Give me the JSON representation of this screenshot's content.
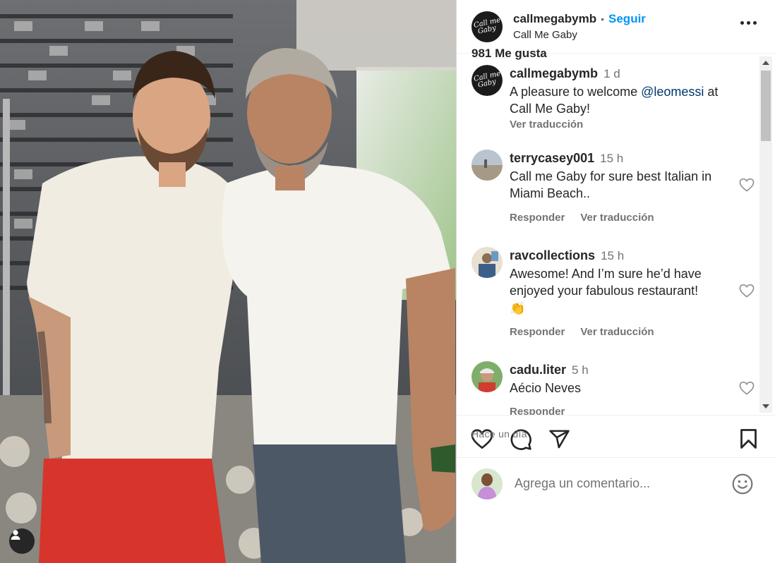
{
  "post": {
    "account": {
      "username": "callmegabymb",
      "follow_label": "Seguir",
      "location": "Call Me Gaby",
      "avatar_lines": [
        "Call me",
        "Gaby"
      ]
    },
    "caption": {
      "username": "callmegabymb",
      "time": "1 d",
      "text_before": "A pleasure to welcome ",
      "mention": "@leomessi",
      "text_after": " at Call Me Gaby!",
      "translate_label": "Ver traducción"
    },
    "comments": [
      {
        "username": "terrycasey001",
        "time": "15 h",
        "text": "Call me Gaby for sure best Italian in Miami Beach..",
        "reply_label": "Responder",
        "translate_label": "Ver traducción"
      },
      {
        "username": "ravcollections",
        "time": "15 h",
        "text": "Awesome! And I’m sure he’d have enjoyed your fabulous restaurant!",
        "emoji": "👏",
        "reply_label": "Responder",
        "translate_label": "Ver traducción"
      },
      {
        "username": "cadu.liter",
        "time": "5 h",
        "text": "Aécio Neves",
        "reply_label": "Responder"
      }
    ],
    "likes_text": "981 Me gusta",
    "posted_when": "Hace un día",
    "add_comment_placeholder": "Agrega un comentario..."
  },
  "icons": {
    "like": "heart-icon",
    "comment": "comment-icon",
    "share": "paper-plane-icon",
    "save": "bookmark-icon",
    "more": "more-dots-icon",
    "emoji": "smiley-icon",
    "tagged_users": "user-icon"
  },
  "colors": {
    "accent": "#0095f6",
    "mention": "#00376b",
    "muted": "#737373",
    "text": "#262626"
  }
}
